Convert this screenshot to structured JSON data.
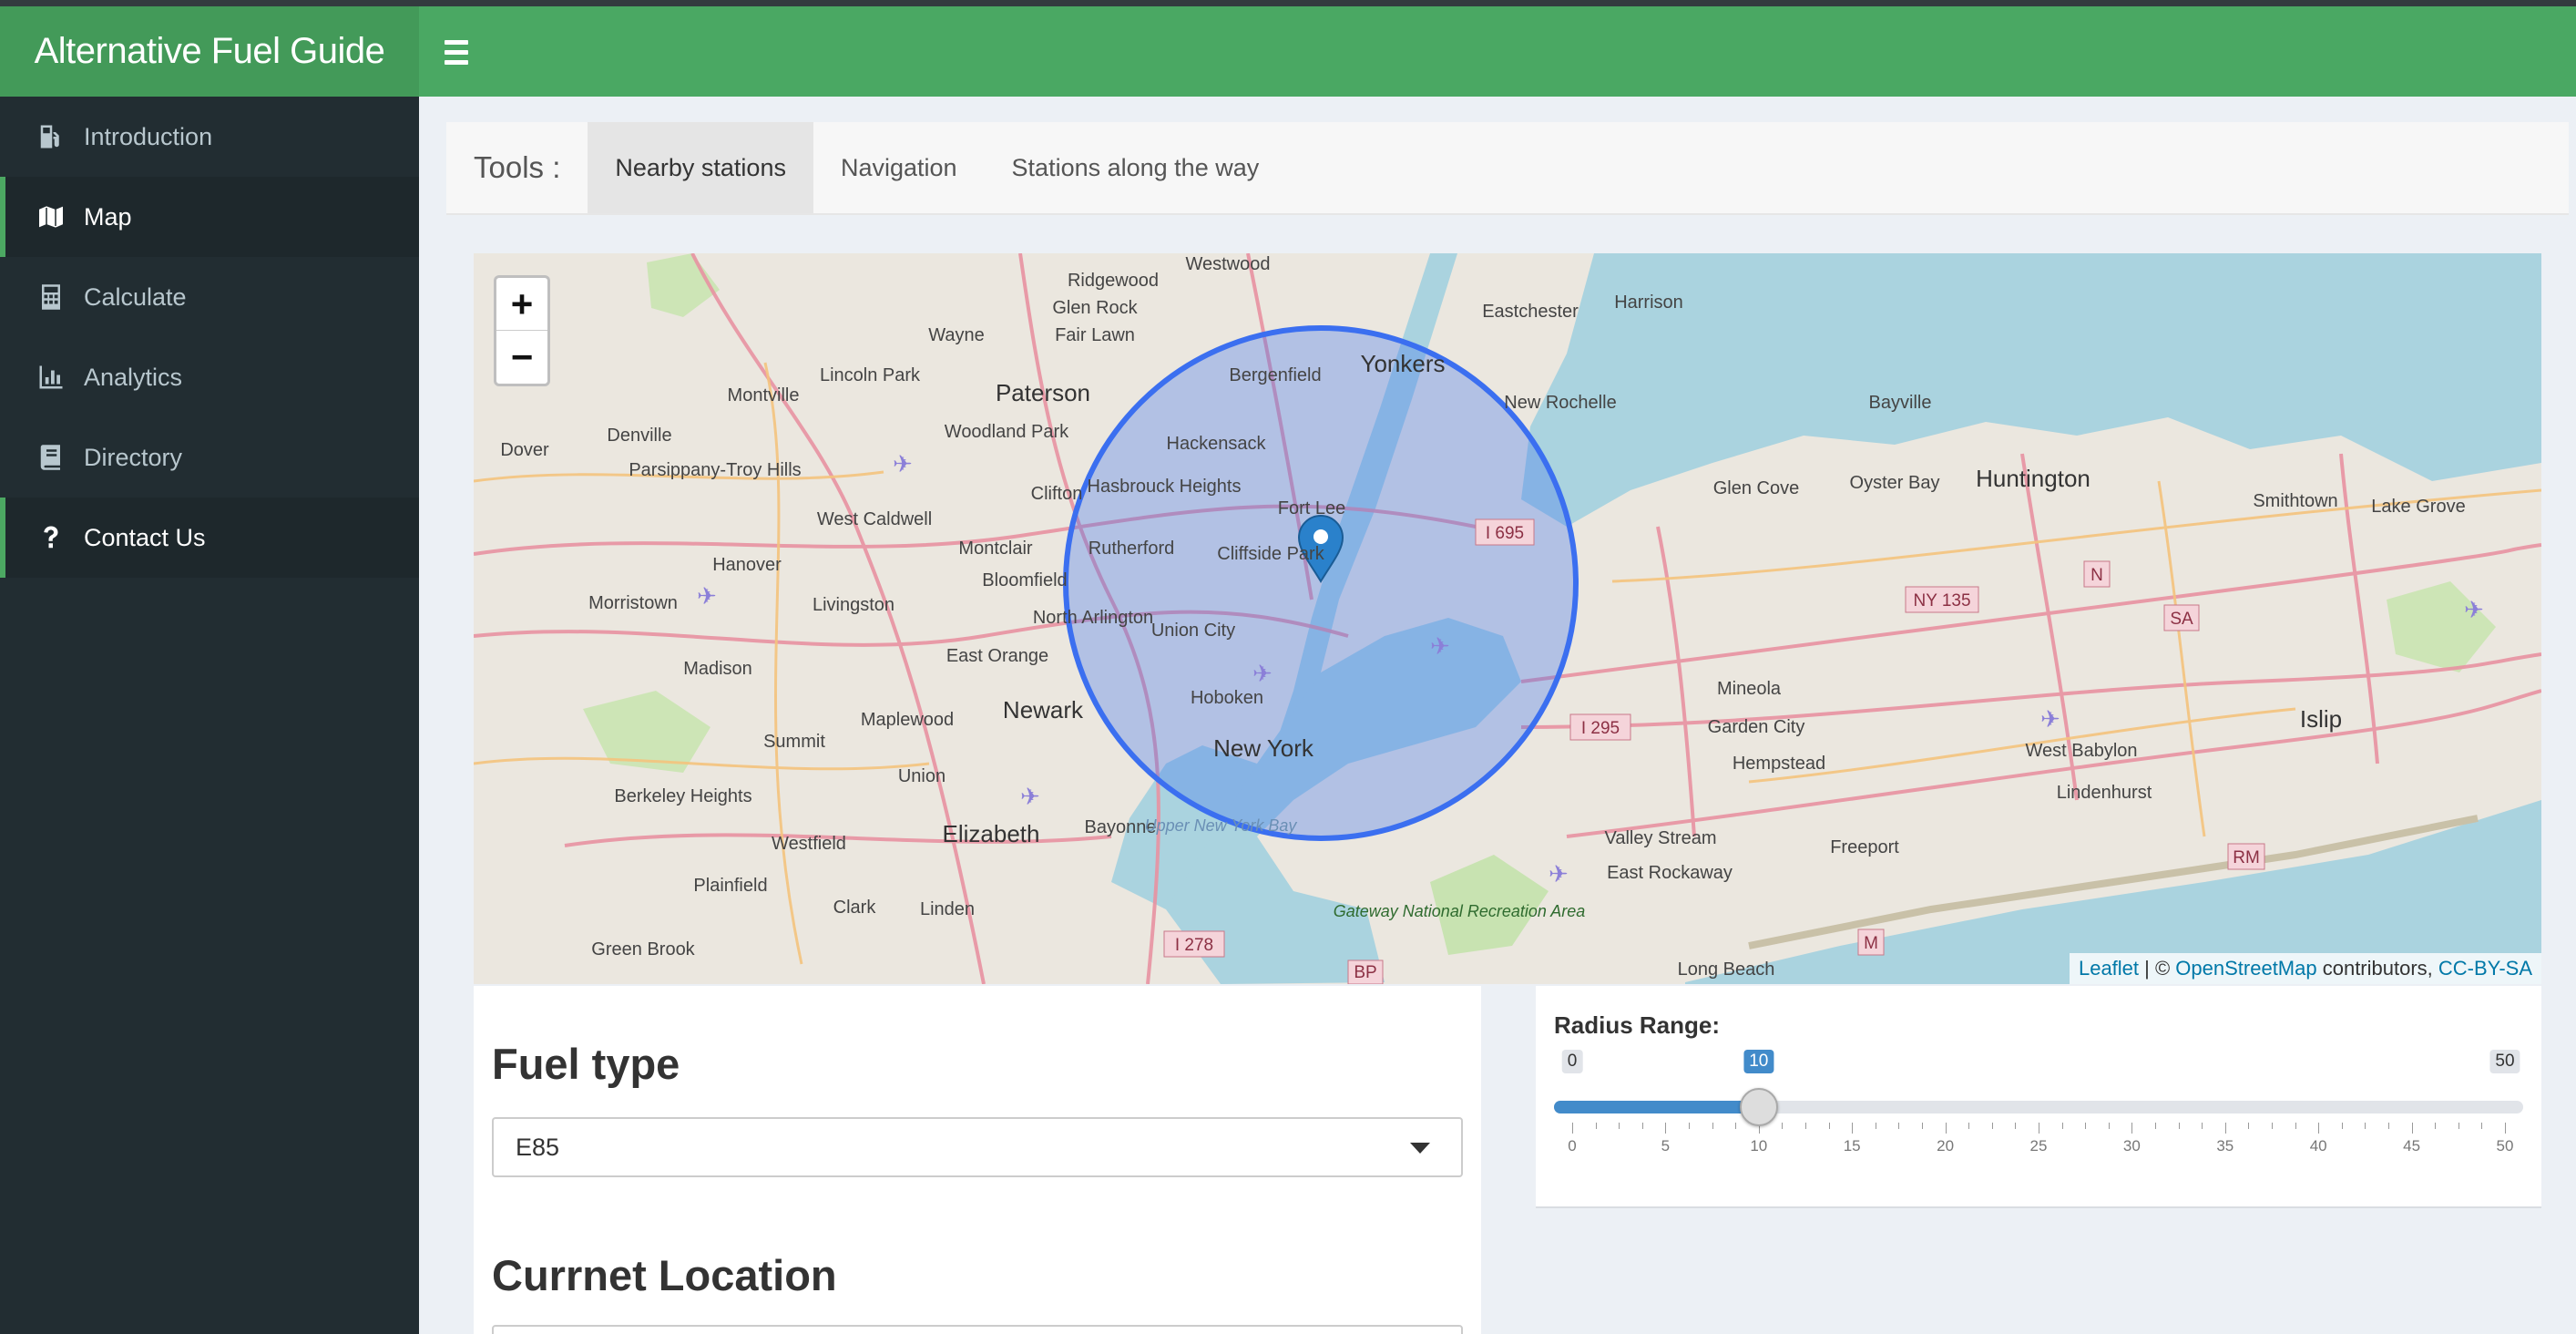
{
  "app": {
    "title": "Alternative Fuel Guide"
  },
  "sidebar": {
    "items": [
      {
        "label": "Introduction",
        "icon": "gas-pump-icon",
        "state": "normal"
      },
      {
        "label": "Map",
        "icon": "map-icon",
        "state": "active"
      },
      {
        "label": "Calculate",
        "icon": "calculator-icon",
        "state": "normal"
      },
      {
        "label": "Analytics",
        "icon": "bar-chart-icon",
        "state": "normal"
      },
      {
        "label": "Directory",
        "icon": "book-icon",
        "state": "normal"
      },
      {
        "label": "Contact Us",
        "icon": "question-icon",
        "state": "highlighted"
      }
    ]
  },
  "tools": {
    "label": "Tools :",
    "tabs": [
      {
        "label": "Nearby stations",
        "active": true
      },
      {
        "label": "Navigation",
        "active": false
      },
      {
        "label": "Stations along the way",
        "active": false
      }
    ]
  },
  "map": {
    "zoom_in": "+",
    "zoom_out": "−",
    "labels": [
      "Westwood",
      "Ridgewood",
      "Glen Rock",
      "Fair Lawn",
      "Wayne",
      "Lincoln Park",
      "Paterson",
      "Montville",
      "Denville",
      "Dover",
      "Woodland Park",
      "Parsippany-Troy Hills",
      "Clifton",
      "Bergenfield",
      "Yonkers",
      "Eastchester",
      "Harrison",
      "New Rochelle",
      "Hackensack",
      "Hasbrouck Heights",
      "Fort Lee",
      "Cliffside Park",
      "Rutherford",
      "West Caldwell",
      "Montclair",
      "Hanover",
      "Bloomfield",
      "Morristown",
      "Livingston",
      "North Arlington",
      "Union City",
      "East Orange",
      "Madison",
      "Hoboken",
      "Newark",
      "Maplewood",
      "New York",
      "Summit",
      "Union",
      "Berkeley Heights",
      "Elizabeth",
      "Bayonne",
      "Westfield",
      "Plainfield",
      "Clark",
      "Linden",
      "Green Brook",
      "Upper New York Bay",
      "Gateway National Recreation Area",
      "Glen Cove",
      "Oyster Bay",
      "Bayville",
      "Huntington",
      "Smithtown",
      "Lake Grove",
      "Mineola",
      "Garden City",
      "Hempstead",
      "Valley Stream",
      "East Rockaway",
      "Freeport",
      "West Babylon",
      "Lindenhurst",
      "Islip",
      "Long Beach"
    ],
    "shields": [
      "I 695",
      "NY 135",
      "N",
      "SA",
      "I 295",
      "I 278",
      "BP",
      "RM",
      "M"
    ],
    "attribution": {
      "leaflet": "Leaflet",
      "sep": " | © ",
      "osm": "OpenStreetMap",
      "contrib": " contributors, ",
      "license": "CC-BY-SA"
    },
    "colors": {
      "water": "#aad3df",
      "land": "#ebe7df",
      "circle": "#3b6ff0",
      "marker": "#2a81cb"
    }
  },
  "fuel": {
    "title": "Fuel type",
    "selected": "E85"
  },
  "location": {
    "title": "Currnet Location"
  },
  "radius": {
    "label": "Radius Range:",
    "min": 0,
    "max": 50,
    "value": 10,
    "min_label": "0",
    "max_label": "50",
    "value_label": "10",
    "tick_labels": [
      "0",
      "5",
      "10",
      "15",
      "20",
      "25",
      "30",
      "35",
      "40",
      "45",
      "50"
    ]
  }
}
